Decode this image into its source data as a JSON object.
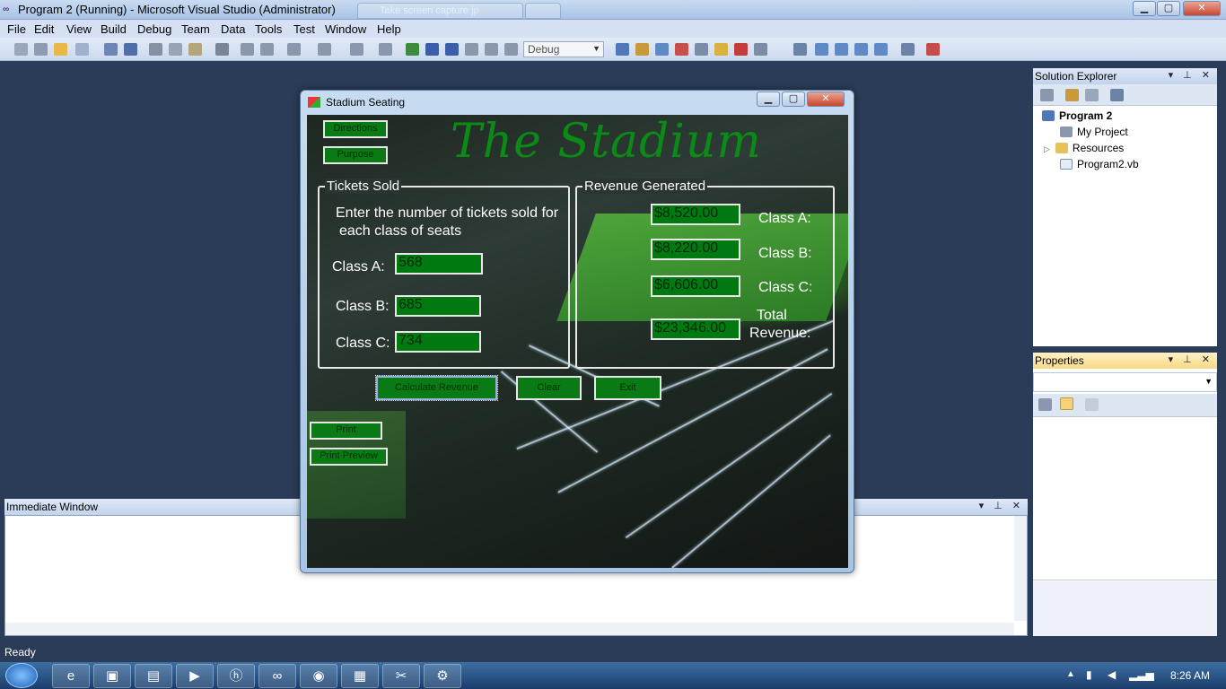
{
  "window": {
    "title": "Program 2 (Running) - Microsoft Visual Studio (Administrator)",
    "ghost_tab_label": "Take screen capture jp"
  },
  "menu": [
    "File",
    "Edit",
    "View",
    "Build",
    "Debug",
    "Team",
    "Data",
    "Tools",
    "Test",
    "Window",
    "Help"
  ],
  "toolbar": {
    "configuration": "Debug"
  },
  "solution_explorer": {
    "title": "Solution Explorer",
    "items": [
      "Program 2",
      "My Project",
      "Resources",
      "Program2.vb"
    ]
  },
  "properties": {
    "title": "Properties"
  },
  "immediate": {
    "title": "Immediate Window"
  },
  "status": {
    "text": "Ready"
  },
  "taskbar": {
    "time": "8:26 AM"
  },
  "app": {
    "title": "Stadium Seating",
    "heading": "The Stadium",
    "buttons": {
      "directions": "Directions",
      "purpose": "Purpose",
      "calculate": "Calculate Revenue",
      "clear": "Clear",
      "exit": "Exit",
      "print": "Print",
      "print_preview": "Print Preview"
    },
    "tickets": {
      "group_title": "Tickets Sold",
      "instruction_line1": "Enter the number of tickets sold for",
      "instruction_line2": "each class of seats",
      "class_a_label": "Class A:",
      "class_a_value": "568",
      "class_b_label": "Class B:",
      "class_b_value": "685",
      "class_c_label": "Class C:",
      "class_c_value": "734"
    },
    "revenue": {
      "group_title": "Revenue Generated",
      "class_a_value": "$8,520.00",
      "class_a_label": "Class A:",
      "class_b_value": "$8,220.00",
      "class_b_label": "Class B:",
      "class_c_value": "$6,606.00",
      "class_c_label": "Class C:",
      "total_value": "$23,346.00",
      "total_label_line1": "Total",
      "total_label_line2": "Revenue:"
    }
  }
}
